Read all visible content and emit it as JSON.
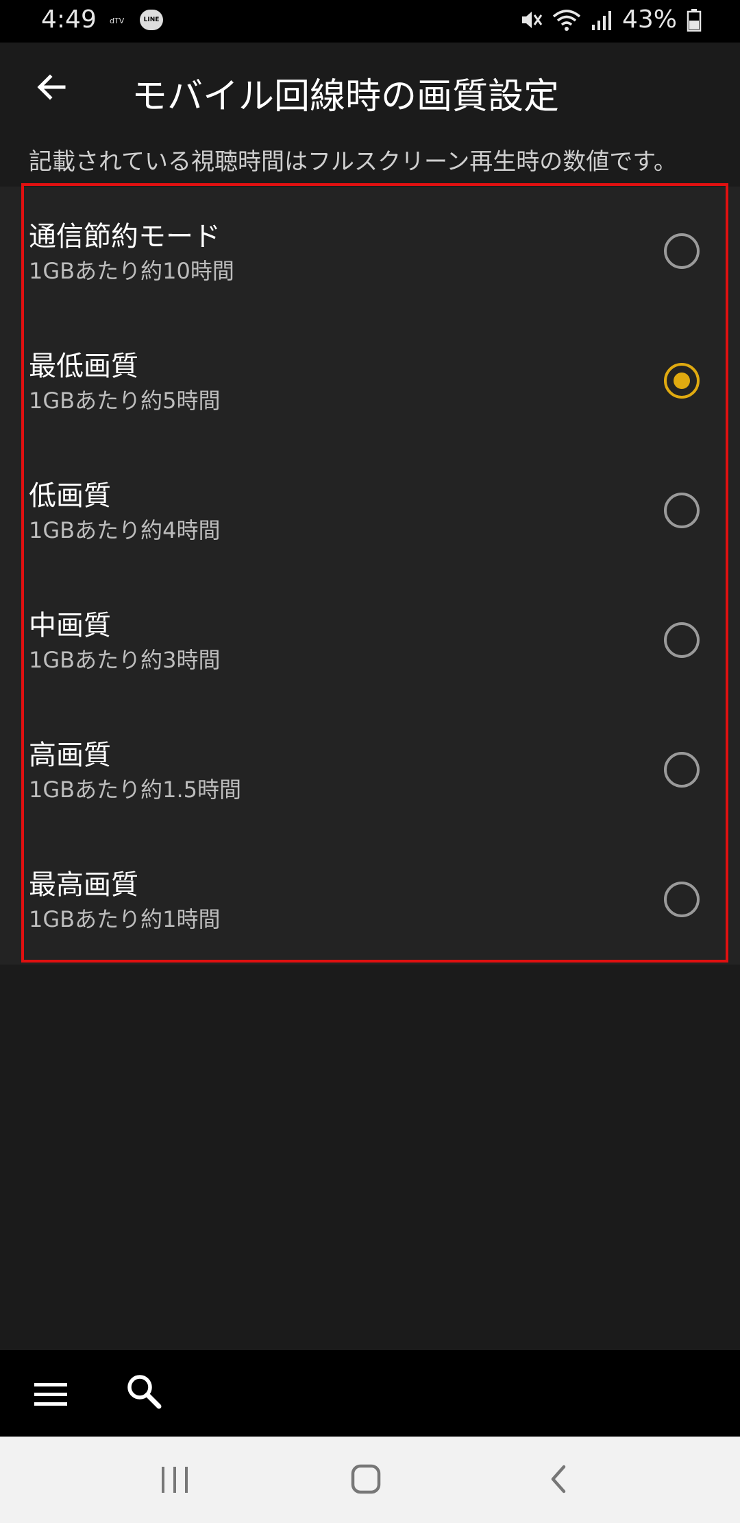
{
  "status_bar": {
    "time": "4:49",
    "app_icons": [
      "dTV",
      "LINE"
    ],
    "battery": "43%"
  },
  "app_bar": {
    "title": "モバイル回線時の画質設定",
    "back_icon": "arrow-left-icon"
  },
  "description": "記載されている視聴時間はフルスクリーン再生時の数値です。",
  "options": [
    {
      "title": "通信節約モード",
      "subtitle": "1GBあたり約10時間",
      "selected": false
    },
    {
      "title": "最低画質",
      "subtitle": "1GBあたり約5時間",
      "selected": true
    },
    {
      "title": "低画質",
      "subtitle": "1GBあたり約4時間",
      "selected": false
    },
    {
      "title": "中画質",
      "subtitle": "1GBあたり約3時間",
      "selected": false
    },
    {
      "title": "高画質",
      "subtitle": "1GBあたり約1.5時間",
      "selected": false
    },
    {
      "title": "最高画質",
      "subtitle": "1GBあたり約1時間",
      "selected": false
    }
  ],
  "colors": {
    "accent": "#e0aa10",
    "highlight": "#e01010",
    "background": "#1b1b1b"
  },
  "bottom_bar": {
    "menu_icon": "hamburger-menu-icon",
    "search_icon": "search-icon"
  },
  "nav_bar": {
    "recent_icon": "recent-apps-icon",
    "home_icon": "home-icon",
    "back_icon": "back-chevron-icon"
  }
}
